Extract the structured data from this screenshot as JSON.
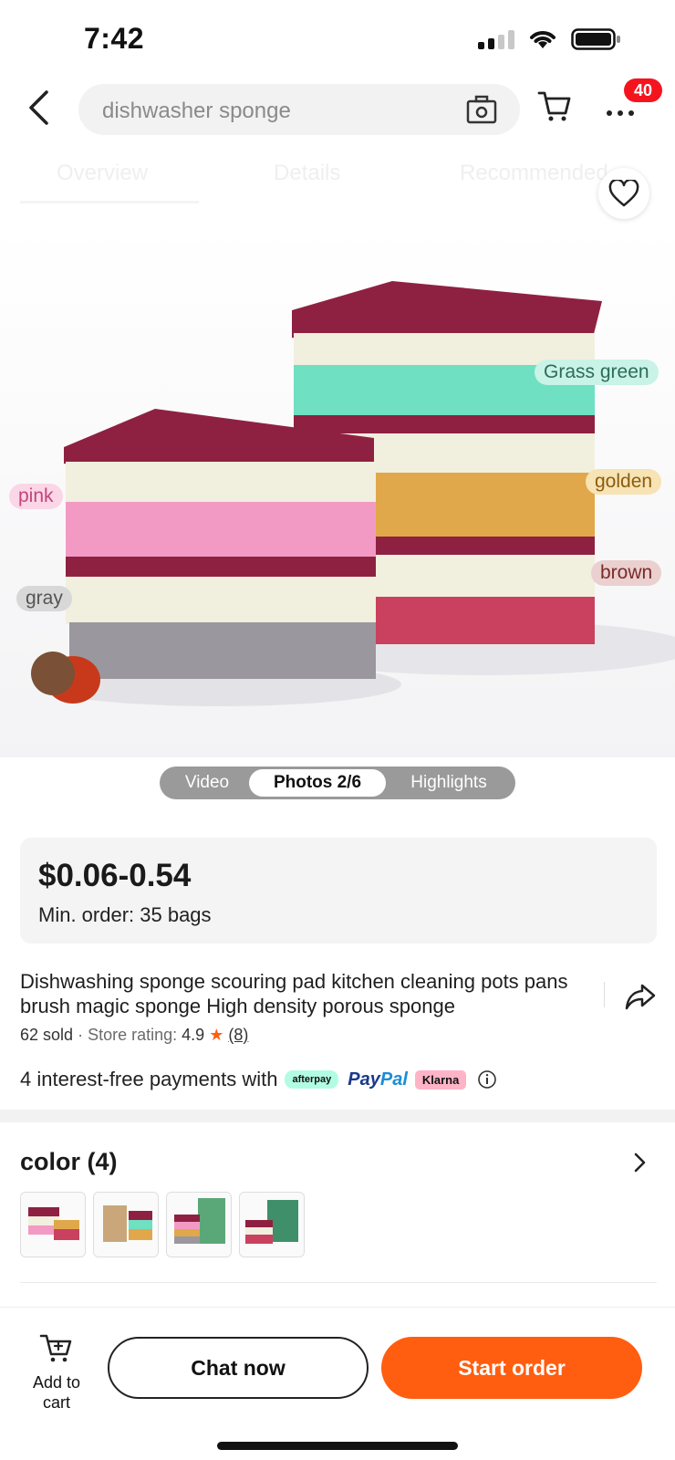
{
  "status_bar": {
    "time": "7:42"
  },
  "header": {
    "search_text": "dishwasher sponge",
    "cart_badge": "40"
  },
  "tabs": [
    "Overview",
    "Details",
    "Recommended"
  ],
  "hero": {
    "color_labels": [
      "pink",
      "gray",
      "Grass green",
      "golden",
      "brown"
    ]
  },
  "media_switch": {
    "items": [
      "Video",
      "Photos 2/6",
      "Highlights"
    ],
    "active": "Photos 2/6"
  },
  "price": {
    "range": "$0.06-0.54",
    "min_order": "Min. order: 35 bags"
  },
  "product": {
    "title": "Dishwashing sponge scouring pad kitchen cleaning pots pans brush magic sponge High density porous sponge",
    "sold": "62 sold",
    "separator": "·",
    "rating_label": "Store rating:",
    "rating_value": "4.9",
    "rating_count": "(8)"
  },
  "payments": {
    "text": "4 interest-free payments with",
    "providers": [
      "afterpay",
      "PayPal",
      "Klarna"
    ]
  },
  "colors": {
    "heading": "color (4)",
    "thumb_count": 4
  },
  "bottom_bar": {
    "add_to_cart": "Add to cart",
    "chat_now": "Chat now",
    "start_order": "Start order"
  },
  "theme": {
    "accent": "#ff5e10",
    "badge": "#f4141e"
  }
}
